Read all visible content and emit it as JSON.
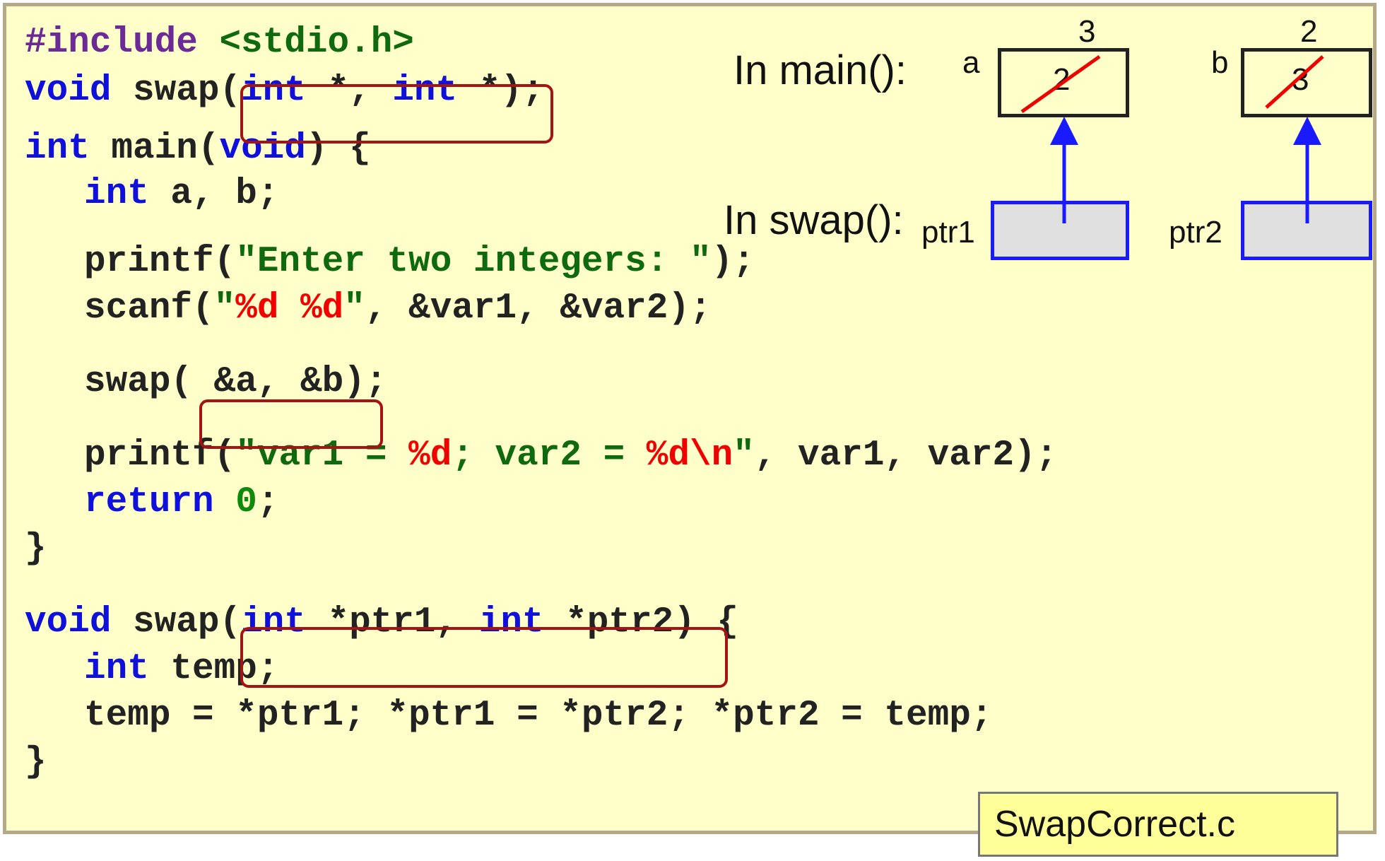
{
  "code": {
    "include_directive": "#include",
    "include_header": "<stdio.h>",
    "proto_void": "void",
    "proto_name": " swap",
    "proto_open": "(",
    "proto_int1": "int",
    "proto_mid": " *, ",
    "proto_int2": "int",
    "proto_star": " *",
    "proto_close": ");",
    "main_int": "int",
    "main_name": " main(",
    "main_void": "void",
    "main_close": ") {",
    "decl_int": "int",
    "decl_rest": " a, b;",
    "printf1_pre": "printf(",
    "printf1_str": "\"Enter two integers: \"",
    "printf1_post": ");",
    "scanf_pre": "scanf(",
    "scanf_q1": "\"",
    "scanf_fmt1": "%d",
    "scanf_space": " ",
    "scanf_fmt2": "%d",
    "scanf_q2": "\"",
    "scanf_post": ", &var1, &var2);",
    "swapcall_pre": "swap(",
    "swapcall_args": " &a, &b",
    "swapcall_post": ");",
    "printf2_pre": "printf(",
    "printf2_q1": "\"",
    "printf2_s1": "var1 = ",
    "printf2_f1": "%d",
    "printf2_s2": "; var2 = ",
    "printf2_f2": "%d\\n",
    "printf2_q2": "\"",
    "printf2_post": ", var1, var2);",
    "return_kw": "return",
    "return_space": " ",
    "return_val": "0",
    "return_semi": ";",
    "main_end": "}",
    "def_void": "void",
    "def_name": " swap",
    "def_open": "(",
    "def_int1": "int",
    "def_p1": " *ptr1, ",
    "def_int2": "int",
    "def_p2": " *ptr2",
    "def_close": ") {",
    "temp_int": "int",
    "temp_rest": " temp;",
    "swap_body": "temp = *ptr1; *ptr1 = *ptr2; *ptr2 = temp;",
    "def_end": "}"
  },
  "diagram": {
    "main_label": "In main():",
    "swap_label": "In swap():",
    "var_a": {
      "name": "a",
      "old_value": "2",
      "new_value": "3"
    },
    "var_b": {
      "name": "b",
      "old_value": "3",
      "new_value": "2"
    },
    "ptr1_label": "ptr1",
    "ptr2_label": "ptr2",
    "cross_color": "#ee0000",
    "arrow_color": "#1a1aff"
  },
  "filename": "SwapCorrect.c"
}
